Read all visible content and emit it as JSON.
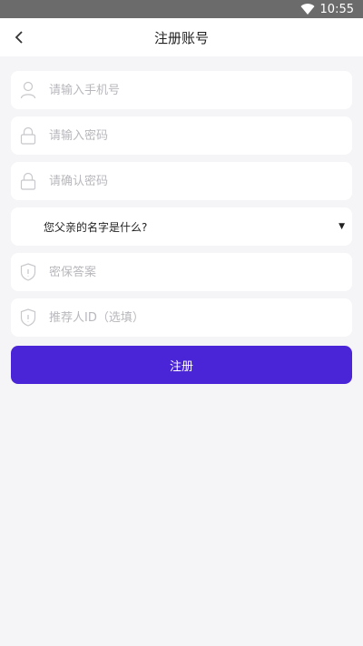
{
  "status_bar": {
    "time": "10:55",
    "icons": [
      "wifi-icon"
    ]
  },
  "header": {
    "title": "注册账号",
    "back_icon": "chevron-left-icon"
  },
  "form": {
    "phone": {
      "placeholder": "请输入手机号",
      "value": "",
      "icon": "user-icon"
    },
    "password": {
      "placeholder": "请输入密码",
      "value": "",
      "icon": "lock-icon"
    },
    "confirm_password": {
      "placeholder": "请确认密码",
      "value": "",
      "icon": "lock-icon"
    },
    "security_question": {
      "selected": "您父亲的名字是什么?",
      "icon": "caret-down-icon"
    },
    "security_answer": {
      "placeholder": "密保答案",
      "value": "",
      "icon": "shield-icon"
    },
    "referrer": {
      "placeholder": "推荐人ID（选填）",
      "value": "",
      "icon": "shield-icon"
    },
    "submit_label": "注册"
  },
  "colors": {
    "accent": "#4a25d8",
    "background": "#f5f5f7",
    "status_bar": "#6b6b6b"
  }
}
